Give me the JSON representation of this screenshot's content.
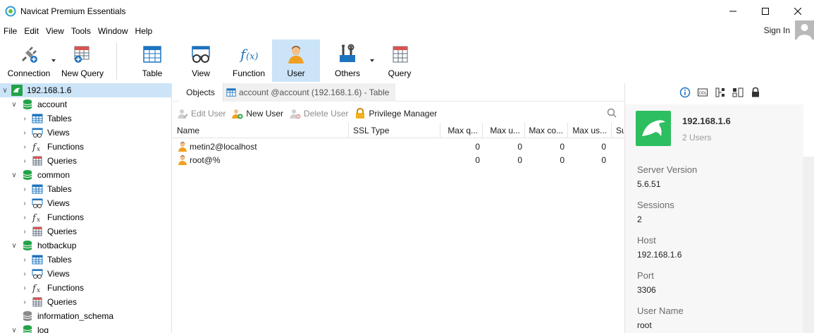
{
  "window": {
    "title": "Navicat Premium Essentials"
  },
  "menu": {
    "items": [
      "File",
      "Edit",
      "View",
      "Tools",
      "Window",
      "Help"
    ],
    "sign_in": "Sign In"
  },
  "toolbar": {
    "connection": "Connection",
    "new_query": "New Query",
    "table": "Table",
    "view": "View",
    "function": "Function",
    "user": "User",
    "others": "Others",
    "query": "Query"
  },
  "tree": {
    "connection": "192.168.1.6",
    "databases": [
      {
        "name": "account",
        "children": [
          "Tables",
          "Views",
          "Functions",
          "Queries"
        ]
      },
      {
        "name": "common",
        "children": [
          "Tables",
          "Views",
          "Functions",
          "Queries"
        ]
      },
      {
        "name": "hotbackup",
        "children": [
          "Tables",
          "Views",
          "Functions",
          "Queries"
        ]
      }
    ],
    "information_schema": "information_schema",
    "log": "log"
  },
  "tabs": {
    "objects": "Objects",
    "table_tab": "account @account (192.168.1.6) - Table"
  },
  "object_toolbar": {
    "edit_user": "Edit User",
    "new_user": "New User",
    "delete_user": "Delete User",
    "privilege_manager": "Privilege Manager"
  },
  "grid": {
    "columns": [
      "Name",
      "SSL Type",
      "Max q...",
      "Max u...",
      "Max co...",
      "Max us...",
      "Su"
    ],
    "rows": [
      {
        "name": "metin2@localhost",
        "ssl": "",
        "v1": "0",
        "v2": "0",
        "v3": "0",
        "v4": "0"
      },
      {
        "name": "root@%",
        "ssl": "",
        "v1": "0",
        "v2": "0",
        "v3": "0",
        "v4": "0"
      }
    ]
  },
  "info": {
    "name": "192.168.1.6",
    "subtitle": "2 Users",
    "properties": [
      {
        "label": "Server Version",
        "value": "5.6.51"
      },
      {
        "label": "Sessions",
        "value": "2"
      },
      {
        "label": "Host",
        "value": "192.168.1.6"
      },
      {
        "label": "Port",
        "value": "3306"
      },
      {
        "label": "User Name",
        "value": "root"
      }
    ]
  },
  "colors": {
    "selection": "#cce4f7",
    "db_green": "#23a347",
    "accent_blue": "#1e73be"
  }
}
